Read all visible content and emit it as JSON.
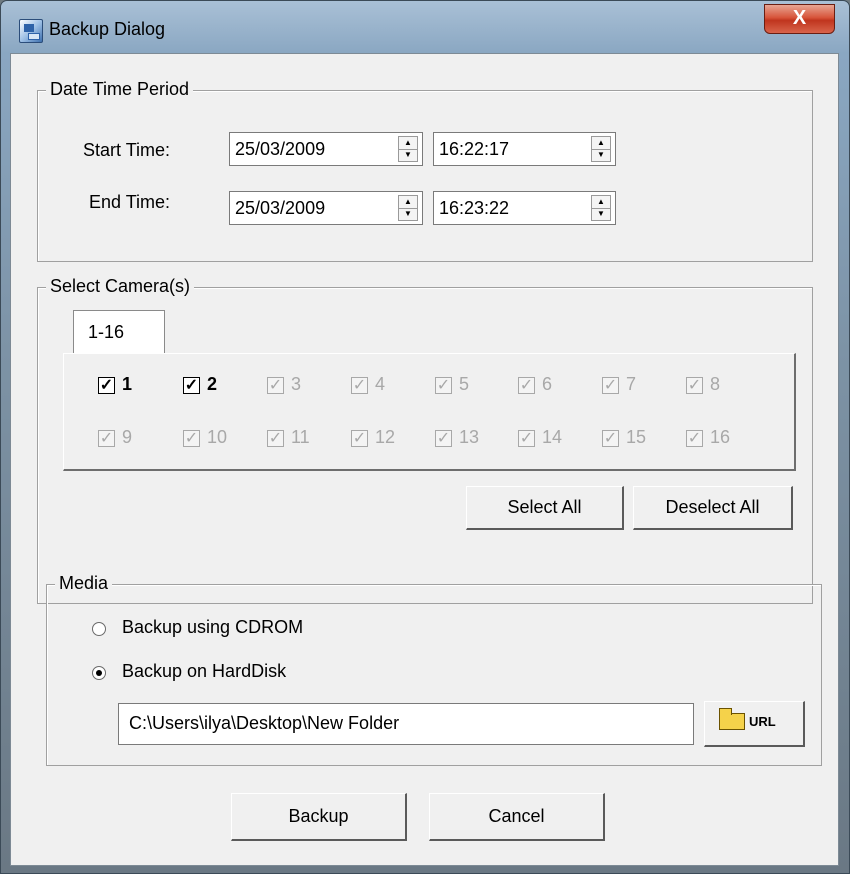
{
  "window": {
    "title": "Backup Dialog",
    "close_label": "X"
  },
  "date_time": {
    "group_label": "Date Time Period",
    "start_label": "Start Time:",
    "start_date": "25/03/2009",
    "start_time": "16:22:17",
    "end_label": "End Time:",
    "end_date": "25/03/2009",
    "end_time": "16:23:22"
  },
  "cameras": {
    "group_label": "Select Camera(s)",
    "tab_label": "1-16",
    "items": [
      {
        "label": "1",
        "checked": true,
        "enabled": true
      },
      {
        "label": "2",
        "checked": true,
        "enabled": true
      },
      {
        "label": "3",
        "checked": true,
        "enabled": false
      },
      {
        "label": "4",
        "checked": true,
        "enabled": false
      },
      {
        "label": "5",
        "checked": true,
        "enabled": false
      },
      {
        "label": "6",
        "checked": true,
        "enabled": false
      },
      {
        "label": "7",
        "checked": true,
        "enabled": false
      },
      {
        "label": "8",
        "checked": true,
        "enabled": false
      },
      {
        "label": "9",
        "checked": true,
        "enabled": false
      },
      {
        "label": "10",
        "checked": true,
        "enabled": false
      },
      {
        "label": "11",
        "checked": true,
        "enabled": false
      },
      {
        "label": "12",
        "checked": true,
        "enabled": false
      },
      {
        "label": "13",
        "checked": true,
        "enabled": false
      },
      {
        "label": "14",
        "checked": true,
        "enabled": false
      },
      {
        "label": "15",
        "checked": true,
        "enabled": false
      },
      {
        "label": "16",
        "checked": true,
        "enabled": false
      }
    ],
    "select_all_label": "Select All",
    "deselect_all_label": "Deselect All"
  },
  "media": {
    "group_label": "Media",
    "options": [
      {
        "label": "Backup using CDROM",
        "selected": false
      },
      {
        "label": "Backup on HardDisk",
        "selected": true
      }
    ],
    "path": "C:\\Users\\ilya\\Desktop\\New Folder",
    "browse_label": "URL"
  },
  "footer": {
    "backup_label": "Backup",
    "cancel_label": "Cancel"
  }
}
